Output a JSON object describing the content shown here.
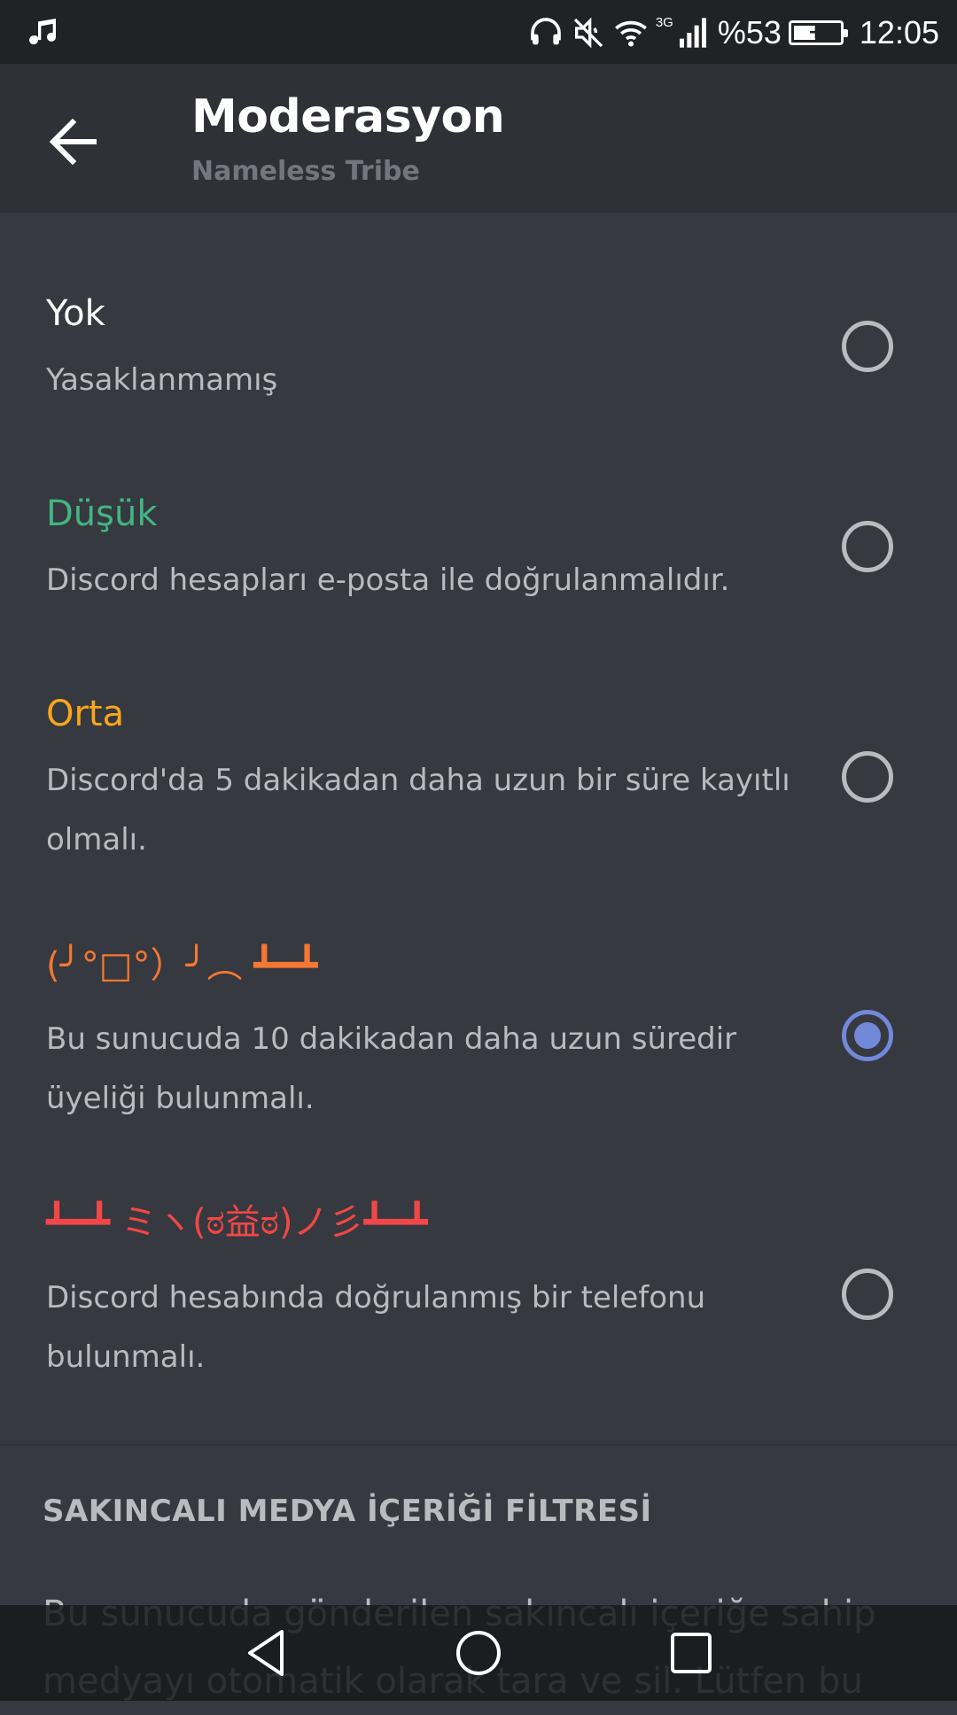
{
  "status_bar": {
    "icons": [
      "music-icon",
      "headphones-icon",
      "mute-icon",
      "wifi-icon",
      "signal-icon",
      "battery-icon"
    ],
    "network": "3G",
    "battery": "%53",
    "battery_level": 0.53,
    "time": "12:05"
  },
  "header": {
    "back_icon": "arrow-left-icon",
    "title": "Moderasyon",
    "subtitle": "Nameless Tribe"
  },
  "verification_levels": [
    {
      "title": "Yok",
      "description": "Yasaklanmamış",
      "color": "#ffffff",
      "selected": false
    },
    {
      "title": "Düşük",
      "description": "Discord hesapları e-posta ile doğrulanmalıdır.",
      "color": "#43b581",
      "selected": false
    },
    {
      "title": "Orta",
      "description": "Discord'da 5 dakikadan daha uzun bir süre kayıtlı olmalı.",
      "color": "#faa61a",
      "selected": false
    },
    {
      "title": "(╯°□°）╯︵ ┻━┻",
      "description": "Bu sunucuda 10 dakikadan daha uzun süredir üyeliği bulunmalı.",
      "color": "#f57731",
      "selected": true
    },
    {
      "title": "┻━┻ ミヽ(ಠ益ಠ)ノ彡┻━┻",
      "description": "Discord hesabında doğrulanmış bir telefonu bulunmalı.",
      "color": "#f04747",
      "selected": false
    }
  ],
  "media_filter": {
    "header": "SAKINCALI MEDYA İÇERİĞİ FİLTRESİ",
    "body": "Bu sunucuda gönderilen sakıncalı içeriğe sahip medyayı otomatik olarak tara ve sil. Lütfen bu"
  },
  "nav_bar": {
    "icons": [
      "back-triangle-icon",
      "home-circle-icon",
      "recents-square-icon"
    ]
  },
  "colors": {
    "background": "#36393f",
    "header": "#2f3136",
    "accent": "#7289da"
  }
}
